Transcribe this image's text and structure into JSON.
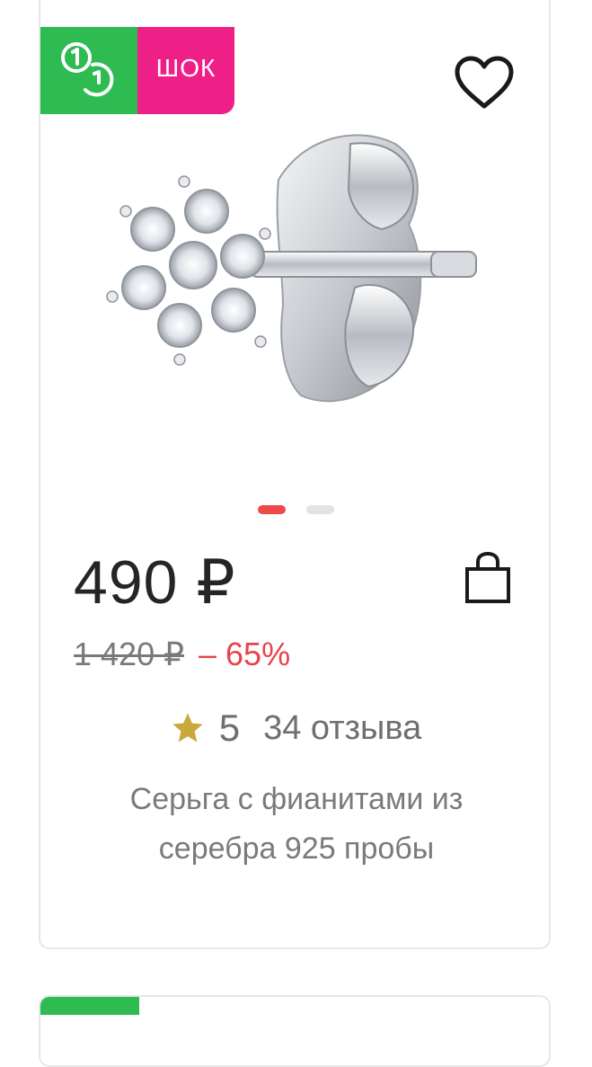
{
  "badges": {
    "green_icon": "coins-icon",
    "shock_label": "ШОК"
  },
  "colors": {
    "green_badge": "#2dbb52",
    "pink_badge": "#ef1f88",
    "discount": "#e8434c",
    "active_dot": "#ef4a4a",
    "star": "#c9a83c"
  },
  "product": {
    "image": "silver-flower-stud-earring",
    "price": "490 ₽",
    "old_price": "1 420 ₽",
    "discount": "– 65%",
    "rating": "5",
    "reviews": "34 отзыва",
    "title_line1": "Серьга с фианитами из",
    "title_line2": "серебра 925 пробы"
  },
  "carousel": {
    "count": 2,
    "active_index": 0
  }
}
